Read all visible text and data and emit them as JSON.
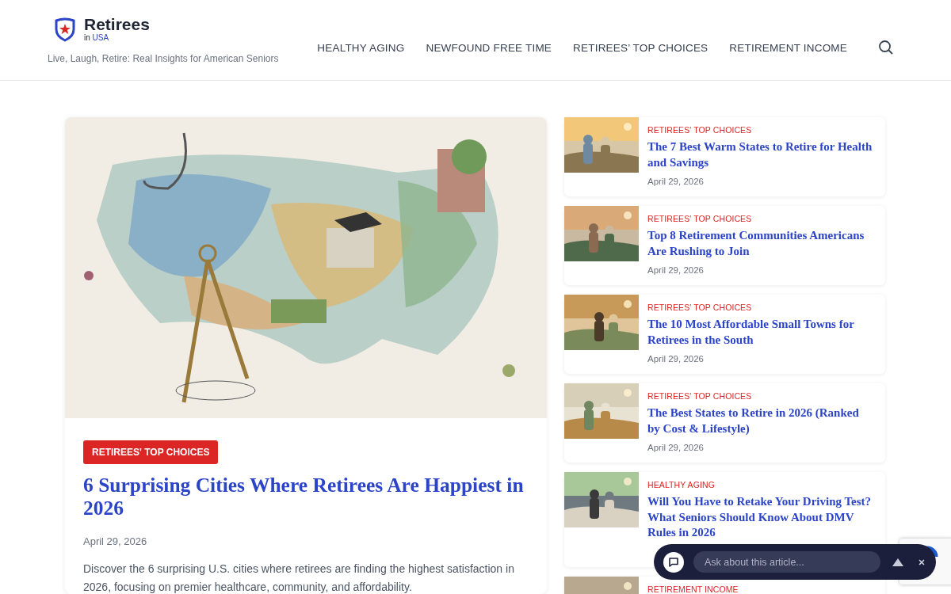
{
  "header": {
    "logo": {
      "name": "Retirees",
      "sub_prefix": "in",
      "sub_highlight": "USA"
    },
    "tagline": "Live, Laugh, Retire: Real Insights for American Seniors",
    "nav": [
      "HEALTHY AGING",
      "NEWFOUND FREE TIME",
      "RETIREES’ TOP CHOICES",
      "RETIREMENT INCOME"
    ]
  },
  "featured": {
    "category": "RETIREES' TOP CHOICES",
    "title": "6 Surprising Cities Where Retirees Are Happiest in 2026",
    "date": "April 29, 2026",
    "excerpt": "Discover the 6 surprising U.S. cities where retirees are finding the highest satisfaction in 2026, focusing on premier healthcare, community, and affordability."
  },
  "sidebar_posts": [
    {
      "category": "RETIREES' TOP CHOICES",
      "title": "The 7 Best Warm States to Retire for Health and Savings",
      "date": "April 29, 2026"
    },
    {
      "category": "RETIREES' TOP CHOICES",
      "title": "Top 8 Retirement Communities Americans Are Rushing to Join",
      "date": "April 29, 2026"
    },
    {
      "category": "RETIREES' TOP CHOICES",
      "title": "The 10 Most Affordable Small Towns for Retirees in the South",
      "date": "April 29, 2026"
    },
    {
      "category": "RETIREES' TOP CHOICES",
      "title": "The Best States to Retire in 2026 (Ranked by Cost & Lifestyle)",
      "date": "April 29, 2026"
    },
    {
      "category": "HEALTHY AGING",
      "title": "Will You Have to Retake Your Driving Test? What Seniors Should Know About DMV Rules in 2026"
    },
    {
      "category": "RETIREMENT INCOME"
    }
  ],
  "chat": {
    "placeholder": "Ask about this article..."
  }
}
